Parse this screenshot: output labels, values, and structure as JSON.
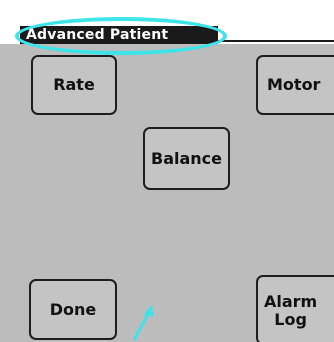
{
  "screen": {
    "title": "Advanced Patient"
  },
  "buttons": {
    "rate": "Rate",
    "motor": "Motor",
    "balance": "Balance",
    "done": "Done",
    "alarm_log": "Alarm\nLog"
  },
  "colors": {
    "background": "#bcbcbc",
    "title_bar": "#1a1a1a",
    "highlight": "#3fe4ea"
  }
}
